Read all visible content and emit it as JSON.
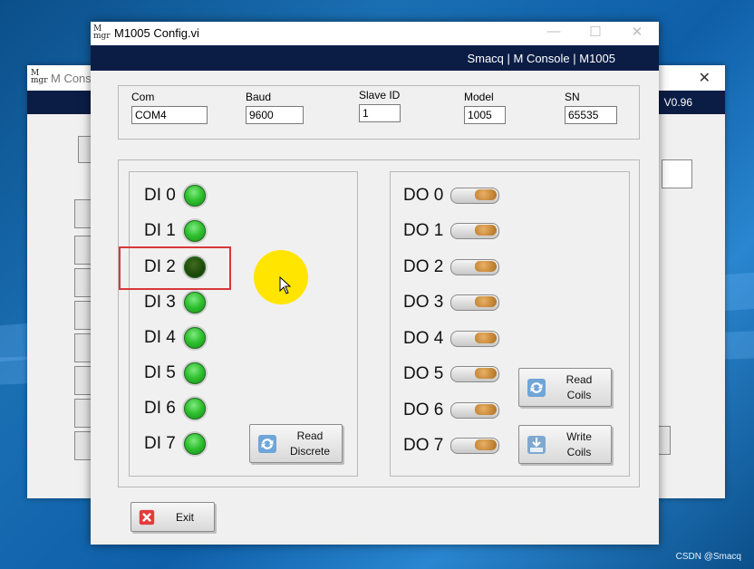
{
  "bg_window": {
    "title": "M Cons",
    "version": "V0.96"
  },
  "window": {
    "title": "M1005 Config.vi",
    "header": "Smacq | M Console | M1005"
  },
  "device": {
    "com_label": "Com",
    "com_value": "COM4",
    "baud_label": "Baud",
    "baud_value": "9600",
    "slave_label": "Slave ID",
    "slave_value": "1",
    "model_label": "Model",
    "model_value": "1005",
    "sn_label": "SN",
    "sn_value": "65535"
  },
  "di": [
    {
      "label": "DI 0",
      "state": "on"
    },
    {
      "label": "DI 1",
      "state": "on"
    },
    {
      "label": "DI 2",
      "state": "off"
    },
    {
      "label": "DI 3",
      "state": "on"
    },
    {
      "label": "DI 4",
      "state": "on"
    },
    {
      "label": "DI 5",
      "state": "on"
    },
    {
      "label": "DI 6",
      "state": "on"
    },
    {
      "label": "DI 7",
      "state": "on"
    }
  ],
  "do": [
    {
      "label": "DO 0"
    },
    {
      "label": "DO 1"
    },
    {
      "label": "DO 2"
    },
    {
      "label": "DO 3"
    },
    {
      "label": "DO 4"
    },
    {
      "label": "DO 5"
    },
    {
      "label": "DO 6"
    },
    {
      "label": "DO 7"
    }
  ],
  "buttons": {
    "read_discrete_1": "Read",
    "read_discrete_2": "Discrete",
    "read_coils_1": "Read",
    "read_coils_2": "Coils",
    "write_coils_1": "Write",
    "write_coils_2": "Coils",
    "exit": "Exit"
  },
  "watermark": "CSDN @Smacq",
  "colors": {
    "header_band": "#0b1d45",
    "led_on": "#2fbf2f",
    "led_off": "#1e4a0a",
    "highlight": "#d8373a",
    "cursor": "#ffe500"
  }
}
